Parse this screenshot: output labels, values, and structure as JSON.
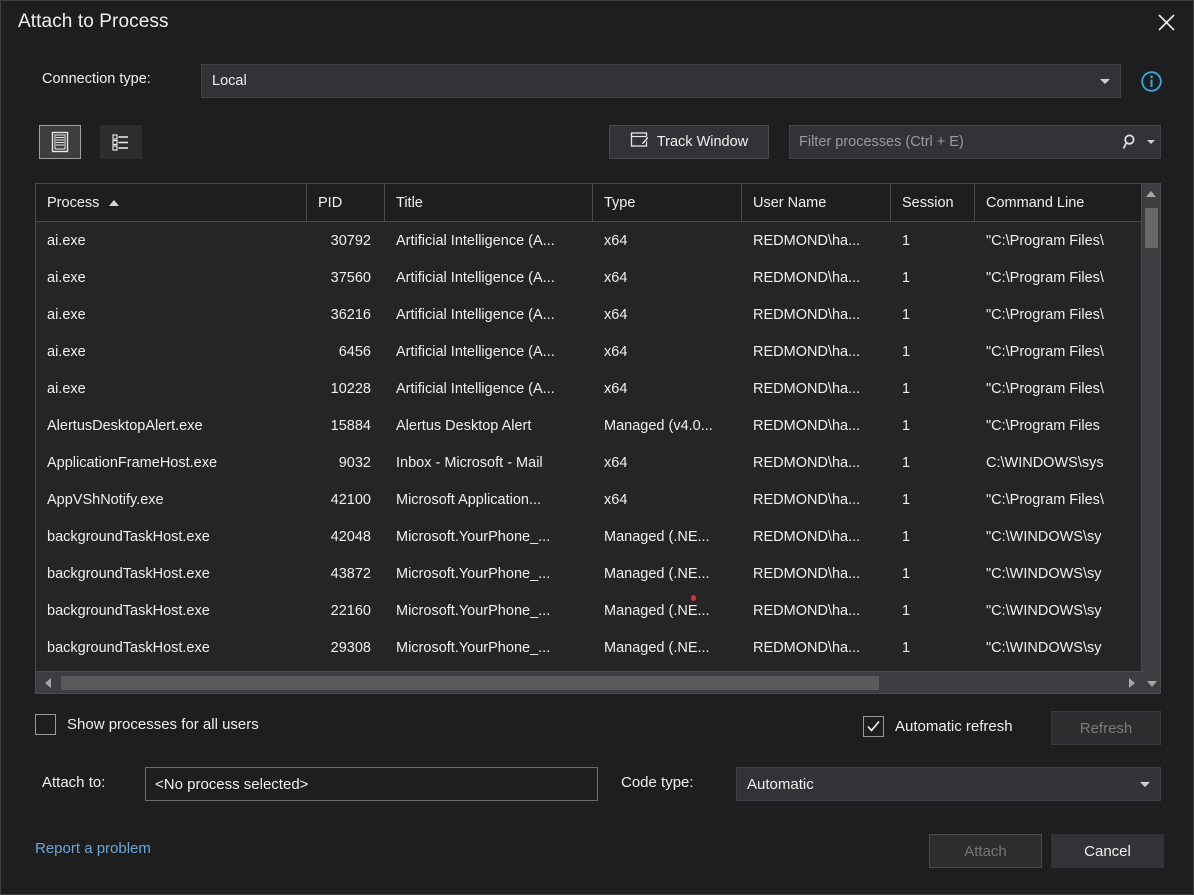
{
  "window": {
    "title": "Attach to Process",
    "close_icon": "close-icon"
  },
  "connection": {
    "label": "Connection type:",
    "value": "Local",
    "info_icon": "info-icon"
  },
  "toolbar": {
    "view_list_icon": "list-view-icon",
    "view_tree_icon": "tree-view-icon",
    "track_window_label": "Track Window",
    "track_window_icon": "window-pen-icon",
    "filter_placeholder": "Filter processes (Ctrl + E)",
    "filter_value": "",
    "search_icon": "search-icon",
    "filter_caret_icon": "chevron-down-icon"
  },
  "grid": {
    "columns": [
      {
        "key": "process",
        "label": "Process",
        "sorted": "asc"
      },
      {
        "key": "pid",
        "label": "PID"
      },
      {
        "key": "title",
        "label": "Title"
      },
      {
        "key": "type",
        "label": "Type"
      },
      {
        "key": "user",
        "label": "User Name"
      },
      {
        "key": "session",
        "label": "Session"
      },
      {
        "key": "cmd",
        "label": "Command Line"
      }
    ],
    "rows": [
      {
        "process": "ai.exe",
        "pid": "30792",
        "title": "Artificial Intelligence (A...",
        "type": "x64",
        "user": "REDMOND\\ha...",
        "session": "1",
        "cmd": "\"C:\\Program Files\\"
      },
      {
        "process": "ai.exe",
        "pid": "37560",
        "title": "Artificial Intelligence (A...",
        "type": "x64",
        "user": "REDMOND\\ha...",
        "session": "1",
        "cmd": "\"C:\\Program Files\\"
      },
      {
        "process": "ai.exe",
        "pid": "36216",
        "title": "Artificial Intelligence (A...",
        "type": "x64",
        "user": "REDMOND\\ha...",
        "session": "1",
        "cmd": "\"C:\\Program Files\\"
      },
      {
        "process": "ai.exe",
        "pid": "6456",
        "title": "Artificial Intelligence (A...",
        "type": "x64",
        "user": "REDMOND\\ha...",
        "session": "1",
        "cmd": "\"C:\\Program Files\\"
      },
      {
        "process": "ai.exe",
        "pid": "10228",
        "title": "Artificial Intelligence (A...",
        "type": "x64",
        "user": "REDMOND\\ha...",
        "session": "1",
        "cmd": "\"C:\\Program Files\\"
      },
      {
        "process": "AlertusDesktopAlert.exe",
        "pid": "15884",
        "title": "Alertus Desktop Alert",
        "type": "Managed (v4.0...",
        "user": "REDMOND\\ha...",
        "session": "1",
        "cmd": "\"C:\\Program Files"
      },
      {
        "process": "ApplicationFrameHost.exe",
        "pid": "9032",
        "title": "Inbox - Microsoft - Mail",
        "type": "x64",
        "user": "REDMOND\\ha...",
        "session": "1",
        "cmd": "C:\\WINDOWS\\sys"
      },
      {
        "process": "AppVShNotify.exe",
        "pid": "42100",
        "title": "Microsoft Application...",
        "type": "x64",
        "user": "REDMOND\\ha...",
        "session": "1",
        "cmd": "\"C:\\Program Files\\"
      },
      {
        "process": "backgroundTaskHost.exe",
        "pid": "42048",
        "title": "Microsoft.YourPhone_...",
        "type": "Managed (.NE...",
        "user": "REDMOND\\ha...",
        "session": "1",
        "cmd": "\"C:\\WINDOWS\\sy"
      },
      {
        "process": "backgroundTaskHost.exe",
        "pid": "43872",
        "title": "Microsoft.YourPhone_...",
        "type": "Managed (.NE...",
        "user": "REDMOND\\ha...",
        "session": "1",
        "cmd": "\"C:\\WINDOWS\\sy"
      },
      {
        "process": "backgroundTaskHost.exe",
        "pid": "22160",
        "title": "Microsoft.YourPhone_...",
        "type": "Managed (.NE...",
        "user": "REDMOND\\ha...",
        "session": "1",
        "cmd": "\"C:\\WINDOWS\\sy"
      },
      {
        "process": "backgroundTaskHost.exe",
        "pid": "29308",
        "title": "Microsoft.YourPhone_...",
        "type": "Managed (.NE...",
        "user": "REDMOND\\ha...",
        "session": "1",
        "cmd": "\"C:\\WINDOWS\\sy"
      }
    ]
  },
  "footer": {
    "show_all_users_label": "Show processes for all users",
    "show_all_users_checked": false,
    "automatic_refresh_label": "Automatic refresh",
    "automatic_refresh_checked": true,
    "refresh_label": "Refresh",
    "attach_to_label": "Attach to:",
    "attach_to_value": "<No process selected>",
    "code_type_label": "Code type:",
    "code_type_value": "Automatic",
    "report_problem_label": "Report a problem",
    "attach_label": "Attach",
    "cancel_label": "Cancel"
  },
  "colors": {
    "background": "#1e1e1e",
    "control": "#333337",
    "border": "#4a4a4d",
    "link": "#6ba6d9",
    "info": "#3ba9e0",
    "marker": "#d9353d"
  }
}
